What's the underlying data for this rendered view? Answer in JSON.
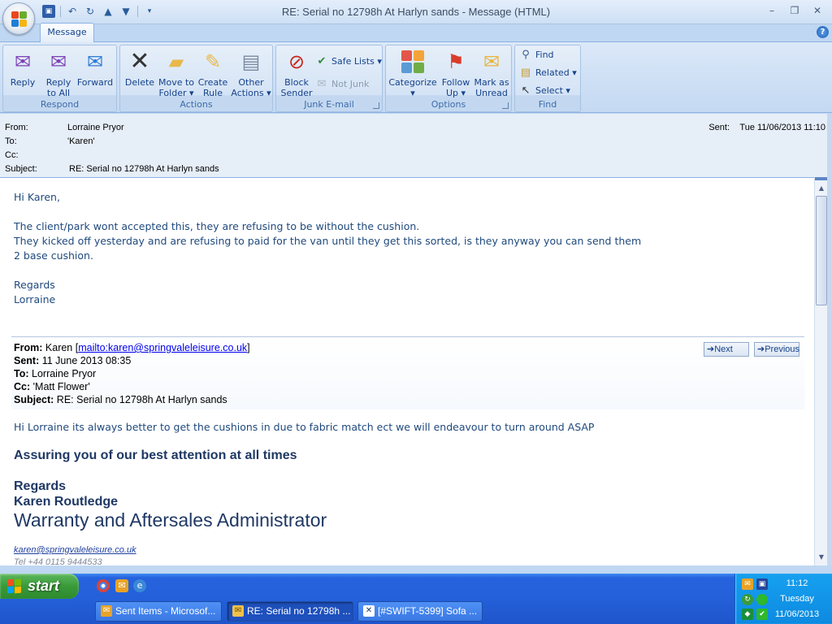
{
  "window": {
    "title": "RE: Serial no 12798h At Harlyn sands - Message (HTML)",
    "controls": {
      "minimize": "–",
      "restore": "❐",
      "close": "✕"
    }
  },
  "ribbon": {
    "tab": "Message",
    "help": "?",
    "groups": {
      "respond": {
        "label": "Respond",
        "reply": {
          "line1": "Reply",
          "line2": ""
        },
        "reply_all": {
          "line1": "Reply",
          "line2": "to All"
        },
        "forward": {
          "line1": "Forward",
          "line2": ""
        }
      },
      "actions": {
        "label": "Actions",
        "delete": {
          "line1": "Delete",
          "line2": ""
        },
        "move_to_folder": {
          "line1": "Move to",
          "line2": "Folder ▾"
        },
        "create_rule": {
          "line1": "Create",
          "line2": "Rule"
        },
        "other_actions": {
          "line1": "Other",
          "line2": "Actions ▾"
        }
      },
      "junk": {
        "label": "Junk E-mail",
        "block_sender": {
          "line1": "Block",
          "line2": "Sender"
        },
        "safe_lists": "Safe Lists ▾",
        "not_junk": "Not Junk"
      },
      "options": {
        "label": "Options",
        "categorize": {
          "line1": "Categorize",
          "line2": "▾"
        },
        "follow_up": {
          "line1": "Follow",
          "line2": "Up ▾"
        },
        "mark_unread": {
          "line1": "Mark as",
          "line2": "Unread"
        }
      },
      "find": {
        "label": "Find",
        "find": "Find",
        "related": "Related ▾",
        "select": "Select ▾"
      }
    }
  },
  "header": {
    "from_label": "From:",
    "from": "Lorraine Pryor",
    "to_label": "To:",
    "to": "'Karen'",
    "cc_label": "Cc:",
    "cc": "",
    "subject_label": "Subject:",
    "subject": "RE: Serial no 12798h At Harlyn sands",
    "sent_label": "Sent:",
    "sent": "Tue 11/06/2013 11:10"
  },
  "body": {
    "greeting": "Hi Karen,",
    "line1": "The client/park wont accepted this, they are refusing to be without the cushion.",
    "line2": "They kicked off yesterday and are refusing to paid for the van until they get this sorted, is they anyway you can send them",
    "line3": "2 base cushion.",
    "regards": "Regards",
    "name": "Lorraine"
  },
  "quoted": {
    "from_label": "From:",
    "from_name": "Karen [",
    "from_link": "mailto:karen@springvaleleisure.co.uk",
    "from_end": "]",
    "sent_label": "Sent:",
    "sent": "11 June 2013 08:35",
    "to_label": "To:",
    "to": "Lorraine Pryor",
    "cc_label": "Cc:",
    "cc": "'Matt Flower'",
    "subject_label": "Subject:",
    "subject": "RE: Serial no 12798h At Harlyn sands",
    "next": "Next",
    "previous": "Previous",
    "message": "Hi Lorraine its always better to get the cushions in due to fabric match ect  we will endeavour to turn around ASAP",
    "assuring": "Assuring you of our best attention at all times",
    "regards": "Regards",
    "sig_name": "Karen Routledge",
    "sig_title": "Warranty and Aftersales Administrator",
    "email": "karen@springvaleleisure.co.uk",
    "tel": "Tel   +44 0115 9444533"
  },
  "taskbar": {
    "start": "start",
    "windows": [
      "Sent Items - Microsof...",
      "RE: Serial no 12798h ...",
      "[#SWIFT-5399] Sofa ..."
    ],
    "time": "11:12",
    "day": "Tuesday",
    "date": "11/06/2013"
  },
  "colors": {
    "accent": "#15428b",
    "body_text": "#1f497d",
    "taskbar": "#245edb",
    "tray": "#0f8fe3"
  }
}
